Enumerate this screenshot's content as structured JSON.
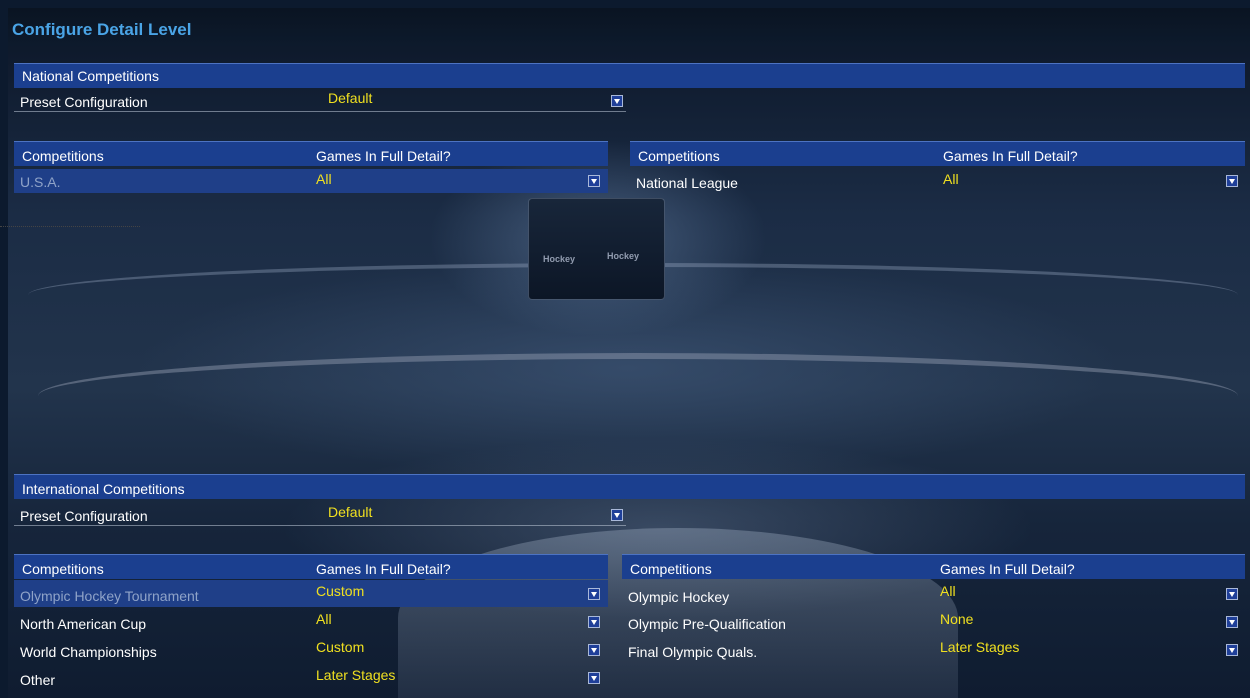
{
  "window": {
    "title": "Configure Detail Level"
  },
  "national": {
    "section_title": "National Competitions",
    "preset": {
      "label": "Preset Configuration",
      "value": "Default"
    },
    "left_table": {
      "col_competitions": "Competitions",
      "col_games": "Games In Full Detail?",
      "rows": [
        {
          "name": "U.S.A.",
          "value": "All"
        }
      ]
    },
    "right_table": {
      "col_competitions": "Competitions",
      "col_games": "Games In Full Detail?",
      "rows": [
        {
          "name": "National League",
          "value": "All"
        }
      ]
    }
  },
  "international": {
    "section_title": "International Competitions",
    "preset": {
      "label": "Preset Configuration",
      "value": "Default"
    },
    "left_table": {
      "col_competitions": "Competitions",
      "col_games": "Games In Full Detail?",
      "rows": [
        {
          "name": "Olympic Hockey Tournament",
          "value": "Custom"
        },
        {
          "name": "North American Cup",
          "value": "All"
        },
        {
          "name": "World Championships",
          "value": "Custom"
        },
        {
          "name": "Other",
          "value": "Later Stages"
        }
      ]
    },
    "right_table": {
      "col_competitions": "Competitions",
      "col_games": "Games In Full Detail?",
      "rows": [
        {
          "name": "Olympic Hockey",
          "value": "All"
        },
        {
          "name": "Olympic Pre-Qualification",
          "value": "None"
        },
        {
          "name": "Final Olympic Quals.",
          "value": "Later Stages"
        }
      ]
    }
  },
  "background": {
    "scoreboard_text_left": "Hockey",
    "scoreboard_text_right": "Hockey"
  },
  "colors": {
    "title_text": "#4aa4e6",
    "header_bar": "#1b3f8f",
    "value_text": "#f0e020",
    "selected_row": "#1f3f88"
  },
  "icons": {
    "dropdown": "chevron-down-icon"
  }
}
